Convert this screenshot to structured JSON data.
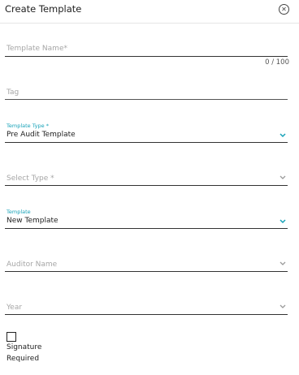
{
  "header": {
    "title": "Create Template"
  },
  "fields": {
    "template_name": {
      "placeholder": "Template Name*",
      "counter": "0 / 100"
    },
    "tag": {
      "placeholder": "Tag"
    },
    "template_type": {
      "label": "Template Type *",
      "value": "Pre Audit Template"
    },
    "select_type": {
      "placeholder": "Select Type *"
    },
    "template": {
      "label": "Template",
      "value": "New Template"
    },
    "auditor_name": {
      "placeholder": "Auditor Name"
    },
    "year": {
      "placeholder": "Year"
    }
  },
  "signature": {
    "label_line1": "Signature",
    "label_line2": "Required",
    "checked": false
  },
  "colors": {
    "accent": "#17a2b8",
    "placeholder": "#a6a6a6",
    "underline": "#333333"
  },
  "icons": {
    "close": "close-circle-icon",
    "dropdown": "chevron-down-icon"
  }
}
